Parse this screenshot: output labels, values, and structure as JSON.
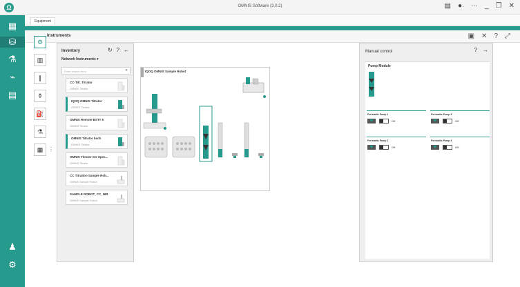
{
  "window": {
    "title": "OMNIS Software (3.0.2)"
  },
  "equipment_tab": "Equipment",
  "main": {
    "title": "Instruments"
  },
  "inventory": {
    "title": "Inventory",
    "filter": "Network Instruments",
    "search_placeholder": "Enter search term",
    "cards": [
      {
        "name": "CC-Tilt_Titrator",
        "type": "OMNIS Titrator"
      },
      {
        "name": "IQOQ OMNIS Titrator",
        "type": "OMNIS Titrator"
      },
      {
        "name": "OMNIS Remote BST# 5",
        "type": "OMNIS Titrator"
      },
      {
        "name": "OMNIS Titrator bsch",
        "type": "OMNIS Titrator"
      },
      {
        "name": "OMNIS Titrator CC-Spec...",
        "type": "OMNIS Titrator"
      },
      {
        "name": "CC Titration Sample Rob...",
        "type": "OMNIS Sample Robot"
      },
      {
        "name": "SAMPLE ROBOT_CC_NIR",
        "type": "OMNIS Sample Robot"
      }
    ]
  },
  "canvas": {
    "title": "IQOQ OMNIS Sample Robot"
  },
  "manual_control": {
    "title": "Manual control",
    "module_title": "Pump Module",
    "pumps": [
      {
        "label": "Peristaltic Pump 1",
        "state": "Off"
      },
      {
        "label": "Peristaltic Pump 3",
        "state": "Off"
      },
      {
        "label": "Peristaltic Pump 2",
        "state": "Off"
      },
      {
        "label": "Peristaltic Pump 4",
        "state": "Off"
      }
    ]
  },
  "colors": {
    "accent": "#279a8e",
    "accent_dark": "#1f7f76"
  }
}
